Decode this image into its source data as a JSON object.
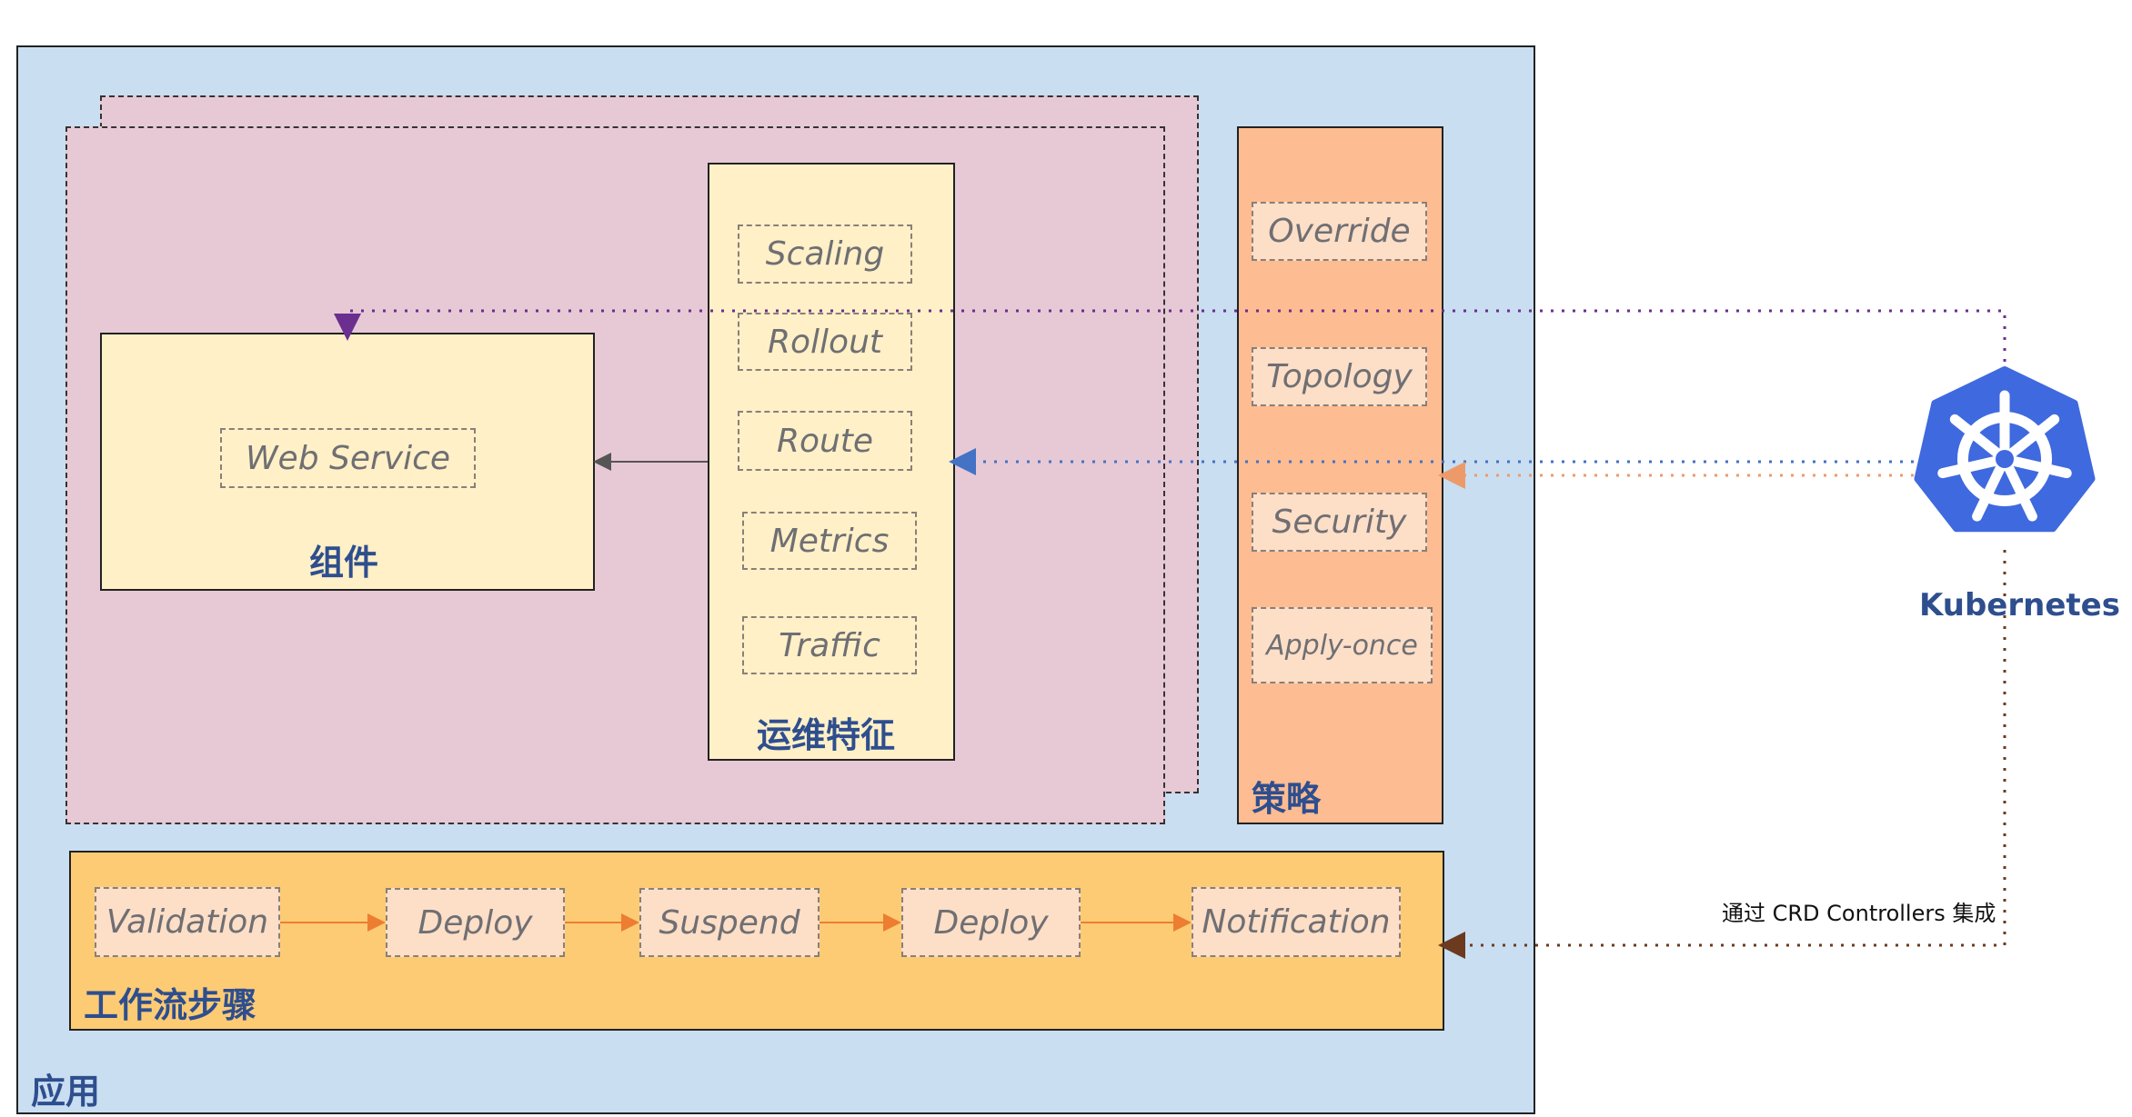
{
  "application": {
    "label": "应用"
  },
  "component": {
    "label": "组件",
    "items": [
      "Web Service"
    ]
  },
  "traits": {
    "label": "运维特征",
    "items": [
      "Scaling",
      "Rollout",
      "Route",
      "Metrics",
      "Traffic"
    ]
  },
  "policies": {
    "label": "策略",
    "items": [
      "Override",
      "Topology",
      "Security",
      "Apply-once"
    ]
  },
  "workflow": {
    "label": "工作流步骤",
    "steps": [
      "Validation",
      "Deploy",
      "Suspend",
      "Deploy",
      "Notification"
    ]
  },
  "kubernetes": {
    "label": "Kubernetes",
    "integration_note": "通过 CRD Controllers 集成"
  },
  "colors": {
    "application_bg": "#C9DEF1",
    "component_group_bg": "#E7C9D5",
    "component_bg": "#FFF0C7",
    "policy_bg": "#FDBC91",
    "workflow_bg": "#FDCB74",
    "item_bg": "#FDDEC7",
    "title_text": "#2E4E8E",
    "kubernetes_blue": "#3F69DF",
    "connector_purple": "#6B2F8F",
    "connector_blue": "#4472C4",
    "connector_orange": "#ED9A6A",
    "connector_brown": "#6B3A1F",
    "workflow_arrow": "#ED7D31"
  }
}
